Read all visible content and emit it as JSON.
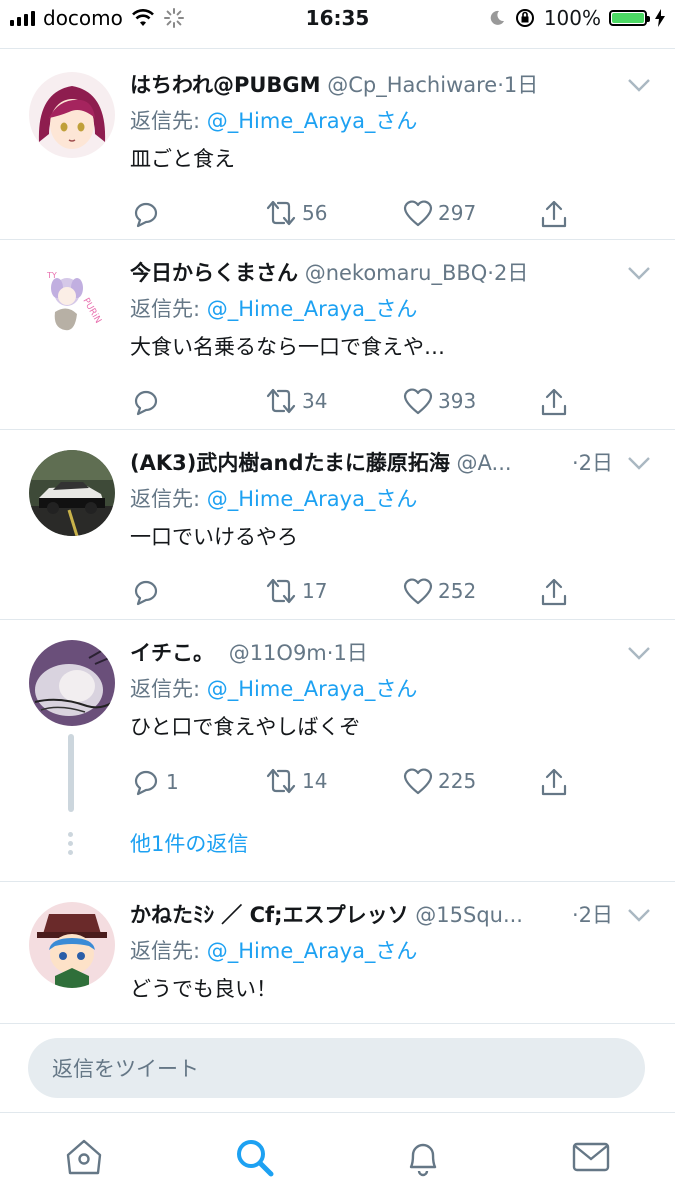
{
  "status": {
    "carrier": "docomo",
    "time": "16:35",
    "battery": "100%",
    "battery_level": 1.0
  },
  "tweets": [
    {
      "name": "はちわれ@PUBGM",
      "handle": "@Cp_Hachiware",
      "time": "·1日",
      "reply_label": "返信先: ",
      "reply_to": "@_Hime_Araya_さん",
      "text": "皿ごと食え",
      "replies": "",
      "retweets": "56",
      "likes": "297"
    },
    {
      "name": "今日からくまさん",
      "handle": "@nekomaru_BBQ",
      "time": "·2日",
      "reply_label": "返信先: ",
      "reply_to": "@_Hime_Araya_さん",
      "text": "大食い名乗るなら一口で食えや…",
      "replies": "",
      "retweets": "34",
      "likes": "393"
    },
    {
      "name": "(AK3)武内樹andたまに藤原拓海",
      "handle": "@A...",
      "time": "·2日",
      "reply_label": "返信先: ",
      "reply_to": "@_Hime_Araya_さん",
      "text": "一口でいけるやろ",
      "replies": "",
      "retweets": "17",
      "likes": "252"
    },
    {
      "name": "イチこ。",
      "handle": "@11O9m",
      "time": "·1日",
      "reply_label": "返信先: ",
      "reply_to": "@_Hime_Araya_さん",
      "text": "ひと口で食えやしばくぞ",
      "replies": "1",
      "retweets": "14",
      "likes": "225",
      "more_replies": "他1件の返信"
    },
    {
      "name": "かねたﾐｼ ／ Cf;エスプレッソ",
      "handle": "@15Squ...",
      "time": "·2日",
      "reply_label": "返信先: ",
      "reply_to": "@_Hime_Araya_さん",
      "text": "どうでも良い！"
    }
  ],
  "compose": {
    "placeholder": "返信をツイート"
  },
  "tabs": [
    "home-icon",
    "search-icon",
    "notifications-icon",
    "messages-icon"
  ],
  "colors": {
    "accent": "#1da1f2",
    "muted": "#657786",
    "text": "#14171a",
    "divider": "#e1e8ed"
  }
}
